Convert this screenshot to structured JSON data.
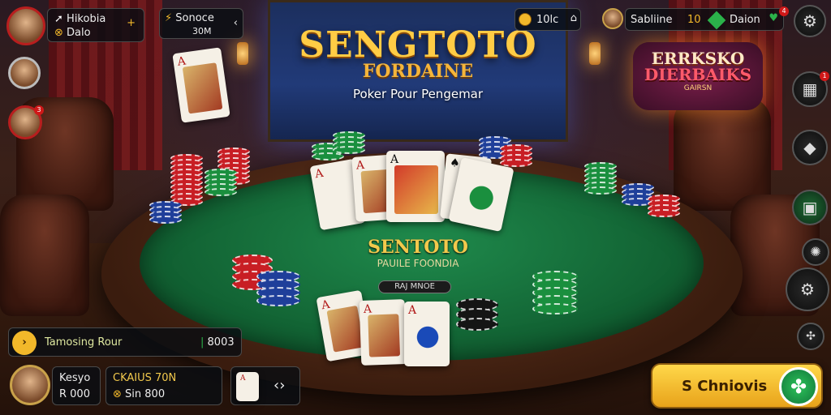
{
  "game": {
    "logo_main": "SENGTOTO",
    "logo_sub": "FORDAINE",
    "tagline": "Poker Pour Pengemar",
    "felt_main": "SENTOTO",
    "felt_sub": "PAUILE FOONDIA",
    "table_pill": "RAJ MNOE"
  },
  "promo": {
    "line1": "ERRKSKO",
    "line2": "DIERBAIKS",
    "line3": "GAIRSN"
  },
  "player": {
    "name": "Hikobia",
    "sub": "Dalo"
  },
  "top_center_panel": {
    "line1": "Sonoce",
    "line2": "30M"
  },
  "top_right": {
    "coins": "10lc",
    "opponent_name": "Sabliine",
    "opponent_num": "10",
    "gems": "Daion"
  },
  "left_bottom_bar": {
    "label": "Tamosing Rour",
    "value": "8003"
  },
  "bottom_panels": {
    "p1_line1": "Kesyo",
    "p1_line2": "R 000",
    "p2_line1": "CKAIUS 70N",
    "p2_line2": "Sin 800"
  },
  "cta": {
    "label": "S Chniovis"
  },
  "badges": {
    "avatar2_badge": "3",
    "top_badge": "4",
    "side_badge": "1"
  },
  "icons": {
    "settings": "gear-icon",
    "home": "home-icon",
    "gem": "gem-icon",
    "coin": "coin-icon",
    "arrows": "double-arrow-icon"
  }
}
